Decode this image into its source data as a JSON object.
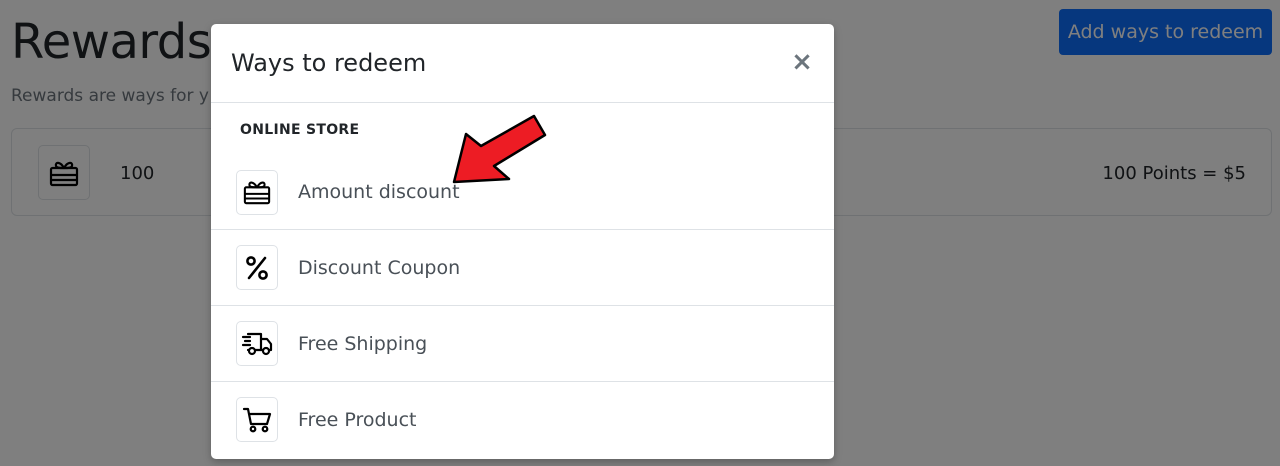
{
  "page": {
    "title": "Rewards",
    "subtitle": "Rewards are ways for y",
    "add_button_label": "Add ways to redeem"
  },
  "reward_card": {
    "icon": "gift-icon",
    "points": "100",
    "value": "100 Points = $5"
  },
  "modal": {
    "title": "Ways to redeem",
    "close_label": "×",
    "section_label": "ONLINE STORE",
    "options": [
      {
        "label": "Amount discount",
        "icon": "gift-icon"
      },
      {
        "label": "Discount Coupon",
        "icon": "percent-icon"
      },
      {
        "label": "Free Shipping",
        "icon": "truck-icon"
      },
      {
        "label": "Free Product",
        "icon": "cart-icon"
      }
    ]
  },
  "colors": {
    "primary": "#0d6efd",
    "backdrop": "rgba(0,0,0,0.5)",
    "arrow": "#ed1c24"
  }
}
